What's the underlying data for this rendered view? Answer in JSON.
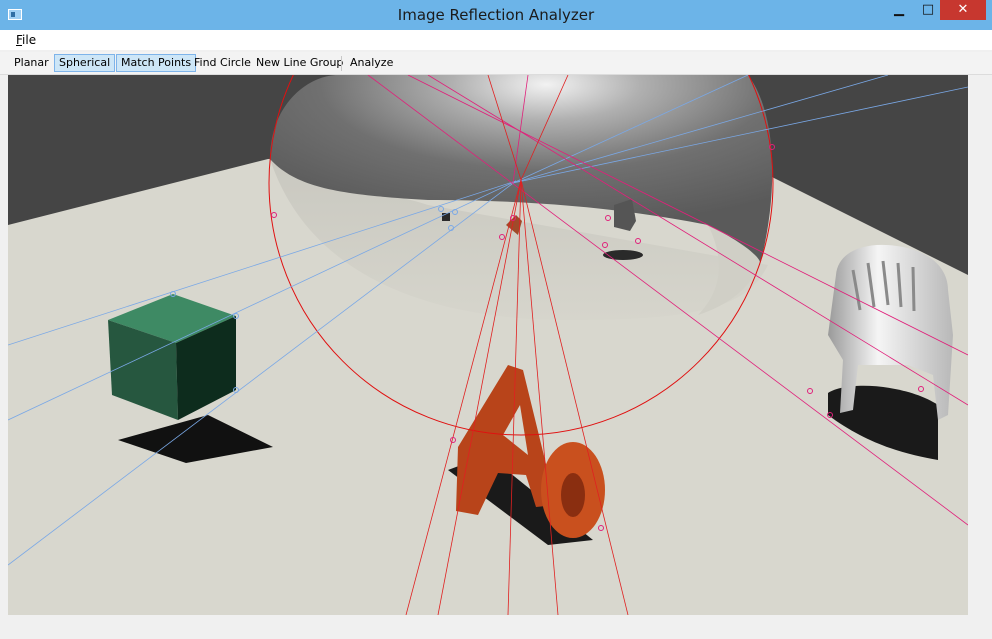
{
  "window": {
    "title": "Image Reflection Analyzer",
    "minimize_glyph": "▁",
    "maximize_glyph": "□",
    "close_glyph": "✕"
  },
  "menu": {
    "file_label_first": "F",
    "file_label_rest": "ile"
  },
  "toolbar": {
    "planar": "Planar",
    "spherical": "Spherical",
    "match_points": "Match Points",
    "find_circle": "Find Circle",
    "new_line_group": "New Line Group",
    "analyze": "Analyze"
  },
  "toolbar_state": {
    "spherical_checked": true,
    "match_points_checked": true
  },
  "colors": {
    "titlebar": "#6cb4e8",
    "circle": "#e01010",
    "blue_lines": "#7aa8e6",
    "pink_lines": "#e0207a",
    "red_lines": "#e02020",
    "floor": "#d8d7ce",
    "wall": "#454545"
  },
  "scene": {
    "description_objects": [
      "green-cube",
      "letters-Aa",
      "white-chair",
      "mirror-sphere"
    ]
  }
}
